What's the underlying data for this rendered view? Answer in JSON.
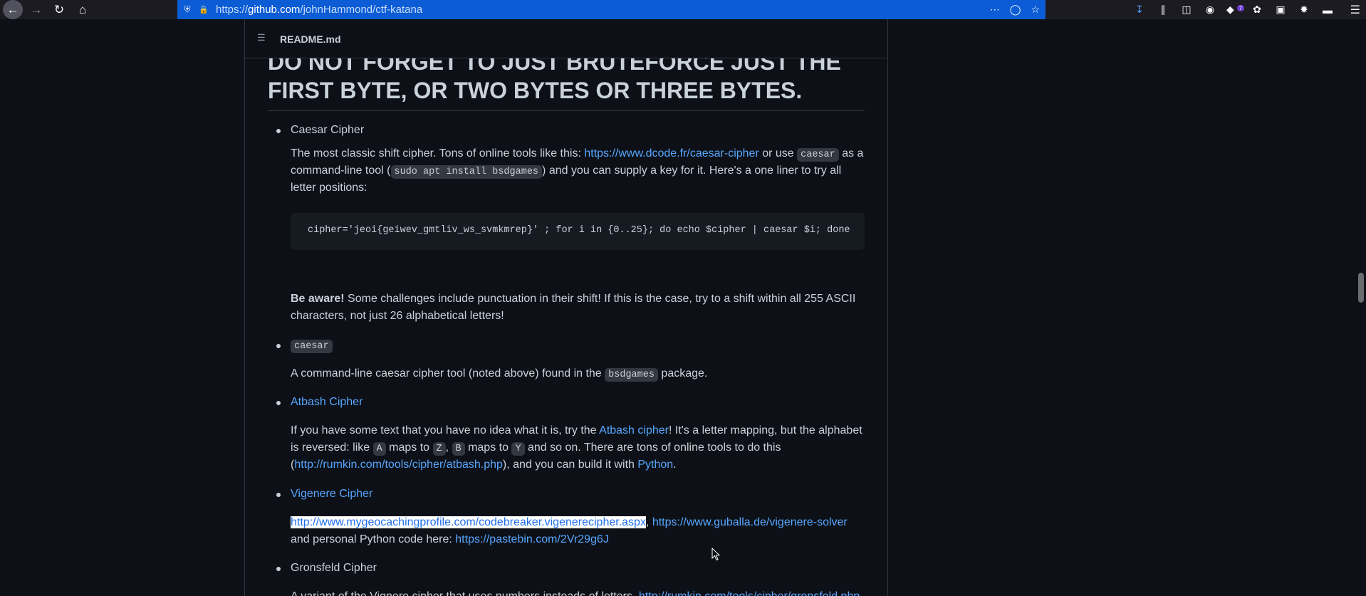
{
  "browser": {
    "url_prefix": "https://",
    "url_host": "github.com",
    "url_path": "/johnHammond/ctf-katana",
    "back_icon": "arrow-left-icon",
    "extension_badge": "7"
  },
  "readme": {
    "title": "README.md"
  },
  "heading": {
    "line1": "DO NOT FORGET TO JUST BRUTEFORCE JUST THE",
    "line2": "FIRST BYTE, OR TWO BYTES OR THREE BYTES."
  },
  "caesar": {
    "title": "Caesar Cipher",
    "p1_a": "The most classic shift cipher. Tons of online tools like this: ",
    "p1_link": "https://www.dcode.fr/caesar-cipher",
    "p1_b": " or use ",
    "p1_code": "caesar",
    "p1_c": " as a",
    "p2_a": "command-line tool (",
    "p2_code": "sudo apt install bsdgames",
    "p2_b": ") and you can supply a key for it. Here's a one liner to try all",
    "p3": "letter positions:",
    "code": "cipher='jeoi{geiwev_gmtliv_ws_svmkmrep}' ; for i in {0..25}; do echo $cipher | caesar $i; done",
    "aware_bold": "Be aware!",
    "aware_a": " Some challenges include punctuation in their shift! If this is the case, try to a shift within all 255 ASCII",
    "aware_b": "characters, not just 26 alphabetical letters!"
  },
  "caesar_tool": {
    "title": "caesar",
    "p_a": "A command-line caesar cipher tool (noted above) found in the ",
    "p_code": "bsdgames",
    "p_b": " package."
  },
  "atbash": {
    "title": "Atbash Cipher",
    "l1_a": "If you have some text that you have no idea what it is, try the ",
    "l1_link": "Atbash cipher",
    "l1_b": "! It's a letter mapping, but the alphabet",
    "l2_a": "is reversed: like ",
    "l2_c1": "A",
    "l2_b": " maps to ",
    "l2_c2": "Z",
    "l2_c": ", ",
    "l2_c3": "B",
    "l2_d": " maps to ",
    "l2_c4": "Y",
    "l2_e": " and so on. There are tons of online tools to do this",
    "l3_a": "(",
    "l3_link": "http://rumkin.com/tools/cipher/atbash.php",
    "l3_b": "), and you can build it with ",
    "l3_link2": "Python",
    "l3_c": "."
  },
  "vigenere": {
    "title": "Vigenere Cipher",
    "l1_link": "http://www.mygeocachingprofile.com/codebreaker.vigenerecipher.aspx",
    "l1_sep": ", ",
    "l1_link2": "https://www.guballa.de/vigenere-solver",
    "l2_a": "and personal Python code here: ",
    "l2_link": "https://pastebin.com/2Vr29g6J"
  },
  "gronsfeld": {
    "title": "Gronsfeld Cipher",
    "l1_a": "A variant of the Vignere cipher that uses numbers insteads of letters. ",
    "l1_link": "http://rumkin.com/tools/cipher/gronsfeld.php"
  }
}
